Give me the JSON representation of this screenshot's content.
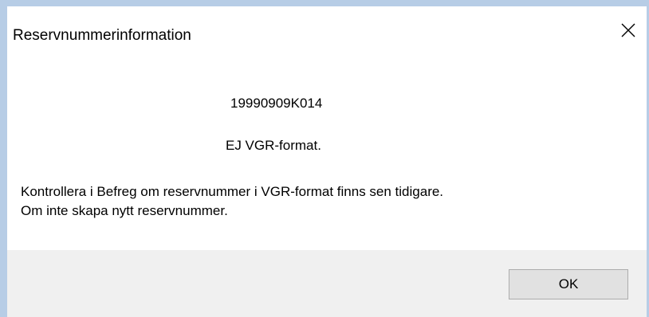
{
  "window": {
    "title": "Reservnummerinformation",
    "close_icon": "close-icon"
  },
  "message": {
    "reserve_number": "19990909K014",
    "format_status": "EJ VGR-format.",
    "instruction_line_1": "Kontrollera i Befreg om reservnummer i VGR-format finns sen tidigare.",
    "instruction_line_2": "Om inte skapa nytt reservnummer."
  },
  "buttons": {
    "ok_label": "OK"
  },
  "colors": {
    "window_border": "#b7cde6",
    "footer_bg": "#f0f0f0",
    "button_bg": "#e1e1e1",
    "button_border": "#adadad"
  }
}
